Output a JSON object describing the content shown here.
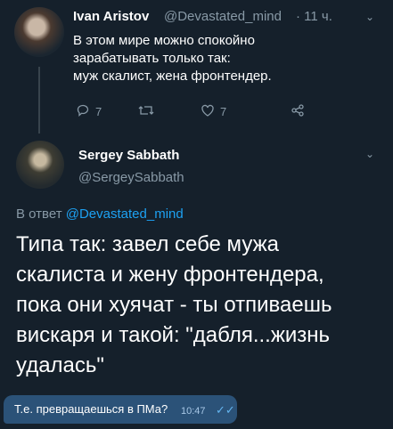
{
  "tweet1": {
    "name": "Ivan Aristov",
    "handle": "@Devastated_mind",
    "time": "· 11 ч.",
    "text_lines": [
      "В этом мире можно спокойно",
      "зарабатывать только так:",
      "муж скалист, жена фронтендер."
    ],
    "counts": {
      "reply": "7",
      "like": "7"
    },
    "icons": [
      "reply-icon",
      "retweet-icon",
      "like-icon",
      "share-icon",
      "chevron-down-icon"
    ]
  },
  "tweet2": {
    "name": "Sergey Sabbath",
    "handle": "@SergeySabbath",
    "reply_prefix": "В ответ",
    "reply_handle": "@Devastated_mind",
    "text_lines": [
      "Типа так: завел себе мужа",
      "скалиста и жену фронтендера,",
      "пока они хуячат - ты отпиваешь",
      "вискаря и такой: \"дабля...жизнь",
      "удалась\""
    ],
    "icons": [
      "chevron-down-icon"
    ]
  },
  "message": {
    "text": "Т.е. превращаешься в ПМа?",
    "time": "10:47",
    "status_icon": "double-check-icon",
    "colors": {
      "bubble": "#2b5278",
      "check": "#64b5ef"
    }
  }
}
